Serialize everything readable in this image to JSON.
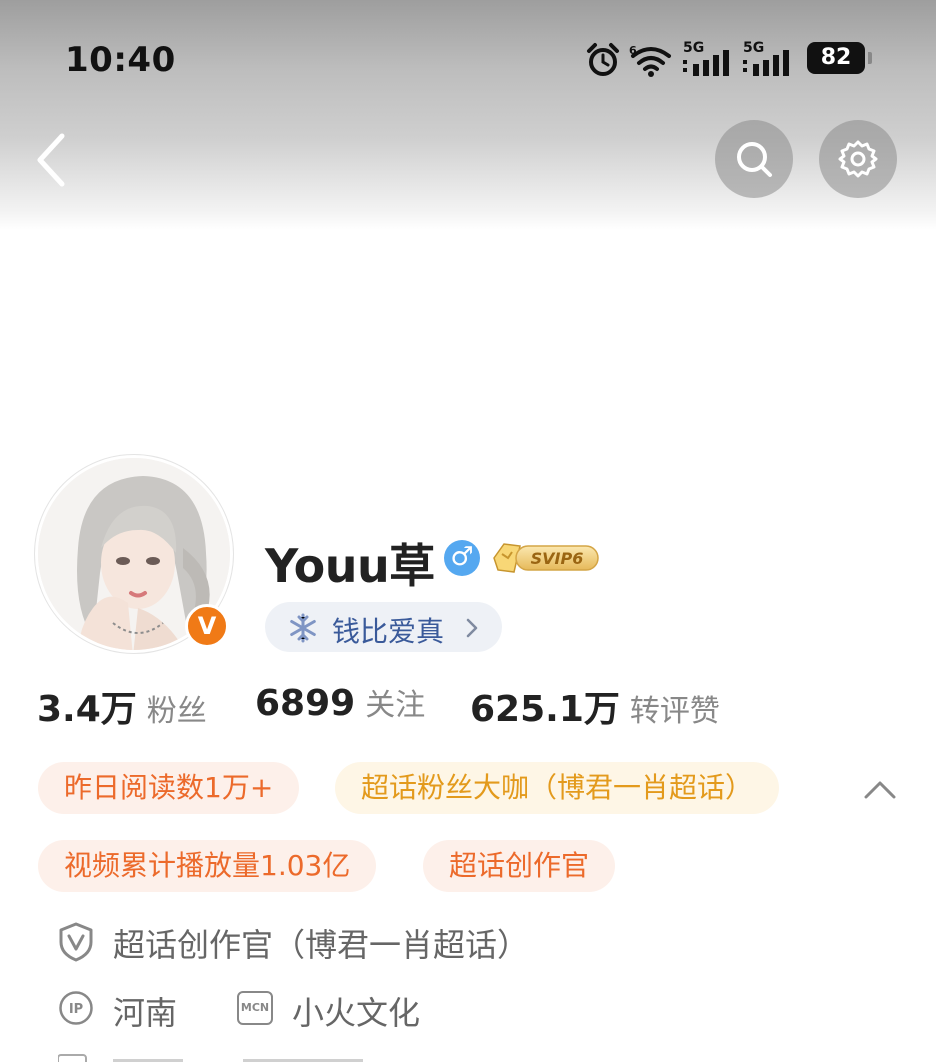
{
  "status_bar": {
    "time": "10:40",
    "network_1": "5G",
    "network_2": "5G",
    "wifi_superscript": "6",
    "battery": "82"
  },
  "nav": {
    "back_icon": "chevron-left-icon",
    "search_icon": "search-icon",
    "settings_icon": "gear-icon"
  },
  "profile": {
    "username": "Youu草",
    "gender_icon": "male-icon",
    "gender_symbol": "♂",
    "vip_badge": "SVIP6",
    "verified_badge": "V",
    "title_pill": "钱比爱真",
    "title_pill_icon": "snowflake-icon"
  },
  "stats": [
    {
      "value": "3.4万",
      "label": "粉丝"
    },
    {
      "value": "6899",
      "label": "关注"
    },
    {
      "value": "625.1万",
      "label": "转评赞"
    }
  ],
  "tags": [
    {
      "text": "昨日阅读数1万+",
      "style": "orange"
    },
    {
      "text": "超话粉丝大咖（博君一肖超话）",
      "style": "gold"
    },
    {
      "text": "视频累计播放量1.03亿",
      "style": "orange"
    },
    {
      "text": "超话创作官",
      "style": "orange"
    }
  ],
  "info": {
    "creator": "超话创作官（博君一肖超话）",
    "ip_icon_label": "IP",
    "location": "河南",
    "mcn_icon_label": "MCN",
    "mcn": "小火文化"
  },
  "colors": {
    "accent_orange": "#ec6a2b",
    "accent_gold": "#e39a1c",
    "verified_orange": "#f07a16",
    "gender_blue": "#55a8f0",
    "pill_blue": "#3a5a9a"
  }
}
